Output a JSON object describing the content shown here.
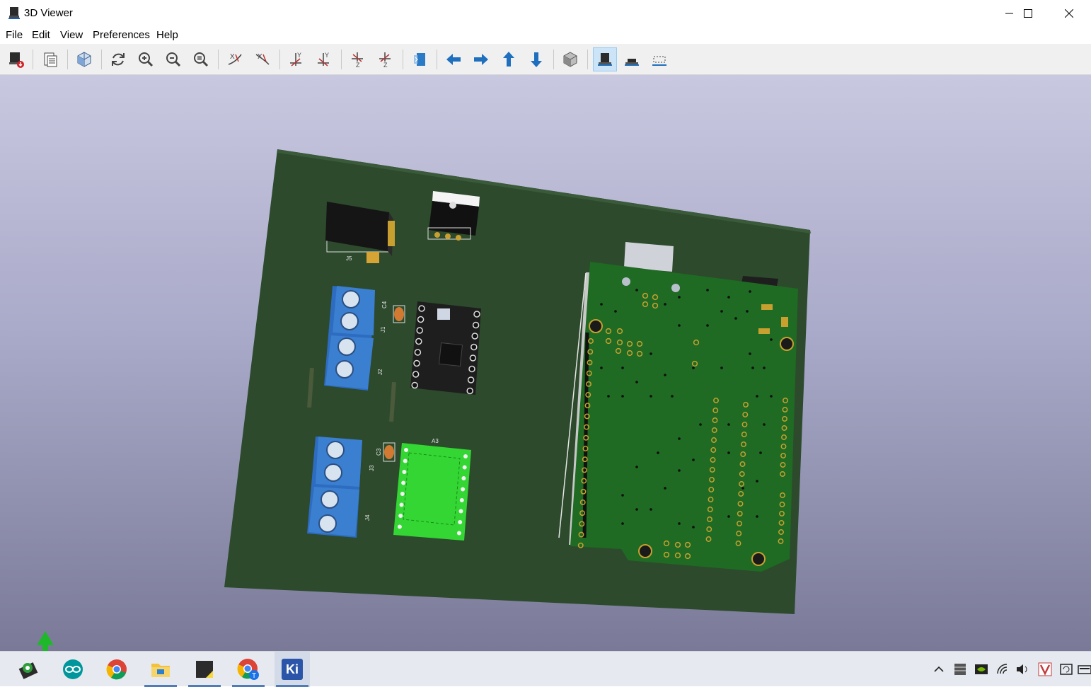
{
  "window": {
    "title": "3D Viewer",
    "icon": "kicad-3d-viewer-icon"
  },
  "menu": {
    "items": [
      "File",
      "Edit",
      "View",
      "Preferences",
      "Help"
    ]
  },
  "toolbar": {
    "buttons": [
      {
        "name": "export-image-icon",
        "tooltip": ""
      },
      {
        "name": "copy-to-clipboard-icon",
        "tooltip": ""
      },
      {
        "name": "raytracing-icon",
        "tooltip": ""
      },
      {
        "name": "reload-icon",
        "tooltip": ""
      },
      {
        "name": "zoom-in-icon",
        "tooltip": ""
      },
      {
        "name": "zoom-out-icon",
        "tooltip": ""
      },
      {
        "name": "zoom-fit-icon",
        "tooltip": ""
      },
      {
        "name": "rotate-x-cw-icon",
        "tooltip": ""
      },
      {
        "name": "rotate-x-ccw-icon",
        "tooltip": ""
      },
      {
        "name": "rotate-y-cw-icon",
        "tooltip": ""
      },
      {
        "name": "rotate-y-ccw-icon",
        "tooltip": ""
      },
      {
        "name": "rotate-z-cw-icon",
        "tooltip": ""
      },
      {
        "name": "rotate-z-ccw-icon",
        "tooltip": ""
      },
      {
        "name": "flip-board-icon",
        "tooltip": ""
      },
      {
        "name": "arrow-left-icon",
        "tooltip": ""
      },
      {
        "name": "arrow-right-icon",
        "tooltip": ""
      },
      {
        "name": "arrow-up-icon",
        "tooltip": ""
      },
      {
        "name": "arrow-down-icon",
        "tooltip": ""
      },
      {
        "name": "ortho-view-icon",
        "tooltip": ""
      },
      {
        "name": "show-tht-icon",
        "tooltip": ""
      },
      {
        "name": "show-smd-icon",
        "tooltip": ""
      },
      {
        "name": "show-virtual-icon",
        "tooltip": ""
      }
    ],
    "active": "show-tht-icon"
  },
  "board": {
    "references": [
      "J5",
      "J1",
      "J2",
      "J3",
      "J4",
      "C4",
      "C3",
      "A3"
    ],
    "colors": {
      "board": "#2d4a2d",
      "terminal_blue": "#3a7fd0",
      "driver_dark": "#222222",
      "driver_green": "#33d633",
      "arduino_green": "#1f6b23",
      "pad_gold": "#c8a030"
    }
  },
  "taskbar": {
    "apps": [
      {
        "name": "kicad-pcbnew-taskbar-icon",
        "running": false
      },
      {
        "name": "arduino-taskbar-icon",
        "running": false
      },
      {
        "name": "chrome-taskbar-icon",
        "running": false
      },
      {
        "name": "file-explorer-taskbar-icon",
        "running": true
      },
      {
        "name": "sticky-notes-taskbar-icon",
        "running": true
      },
      {
        "name": "chrome-profile-taskbar-icon",
        "running": true
      },
      {
        "name": "kicad-taskbar-icon",
        "running": true
      }
    ],
    "kicad_label": "Ki",
    "tray": [
      "show-hidden-icons-icon",
      "storage-icon",
      "nvidia-icon",
      "wifi-icon",
      "volume-icon",
      "vivaldi-tray-icon",
      "action-center-icon",
      "keyboard-icon"
    ]
  }
}
